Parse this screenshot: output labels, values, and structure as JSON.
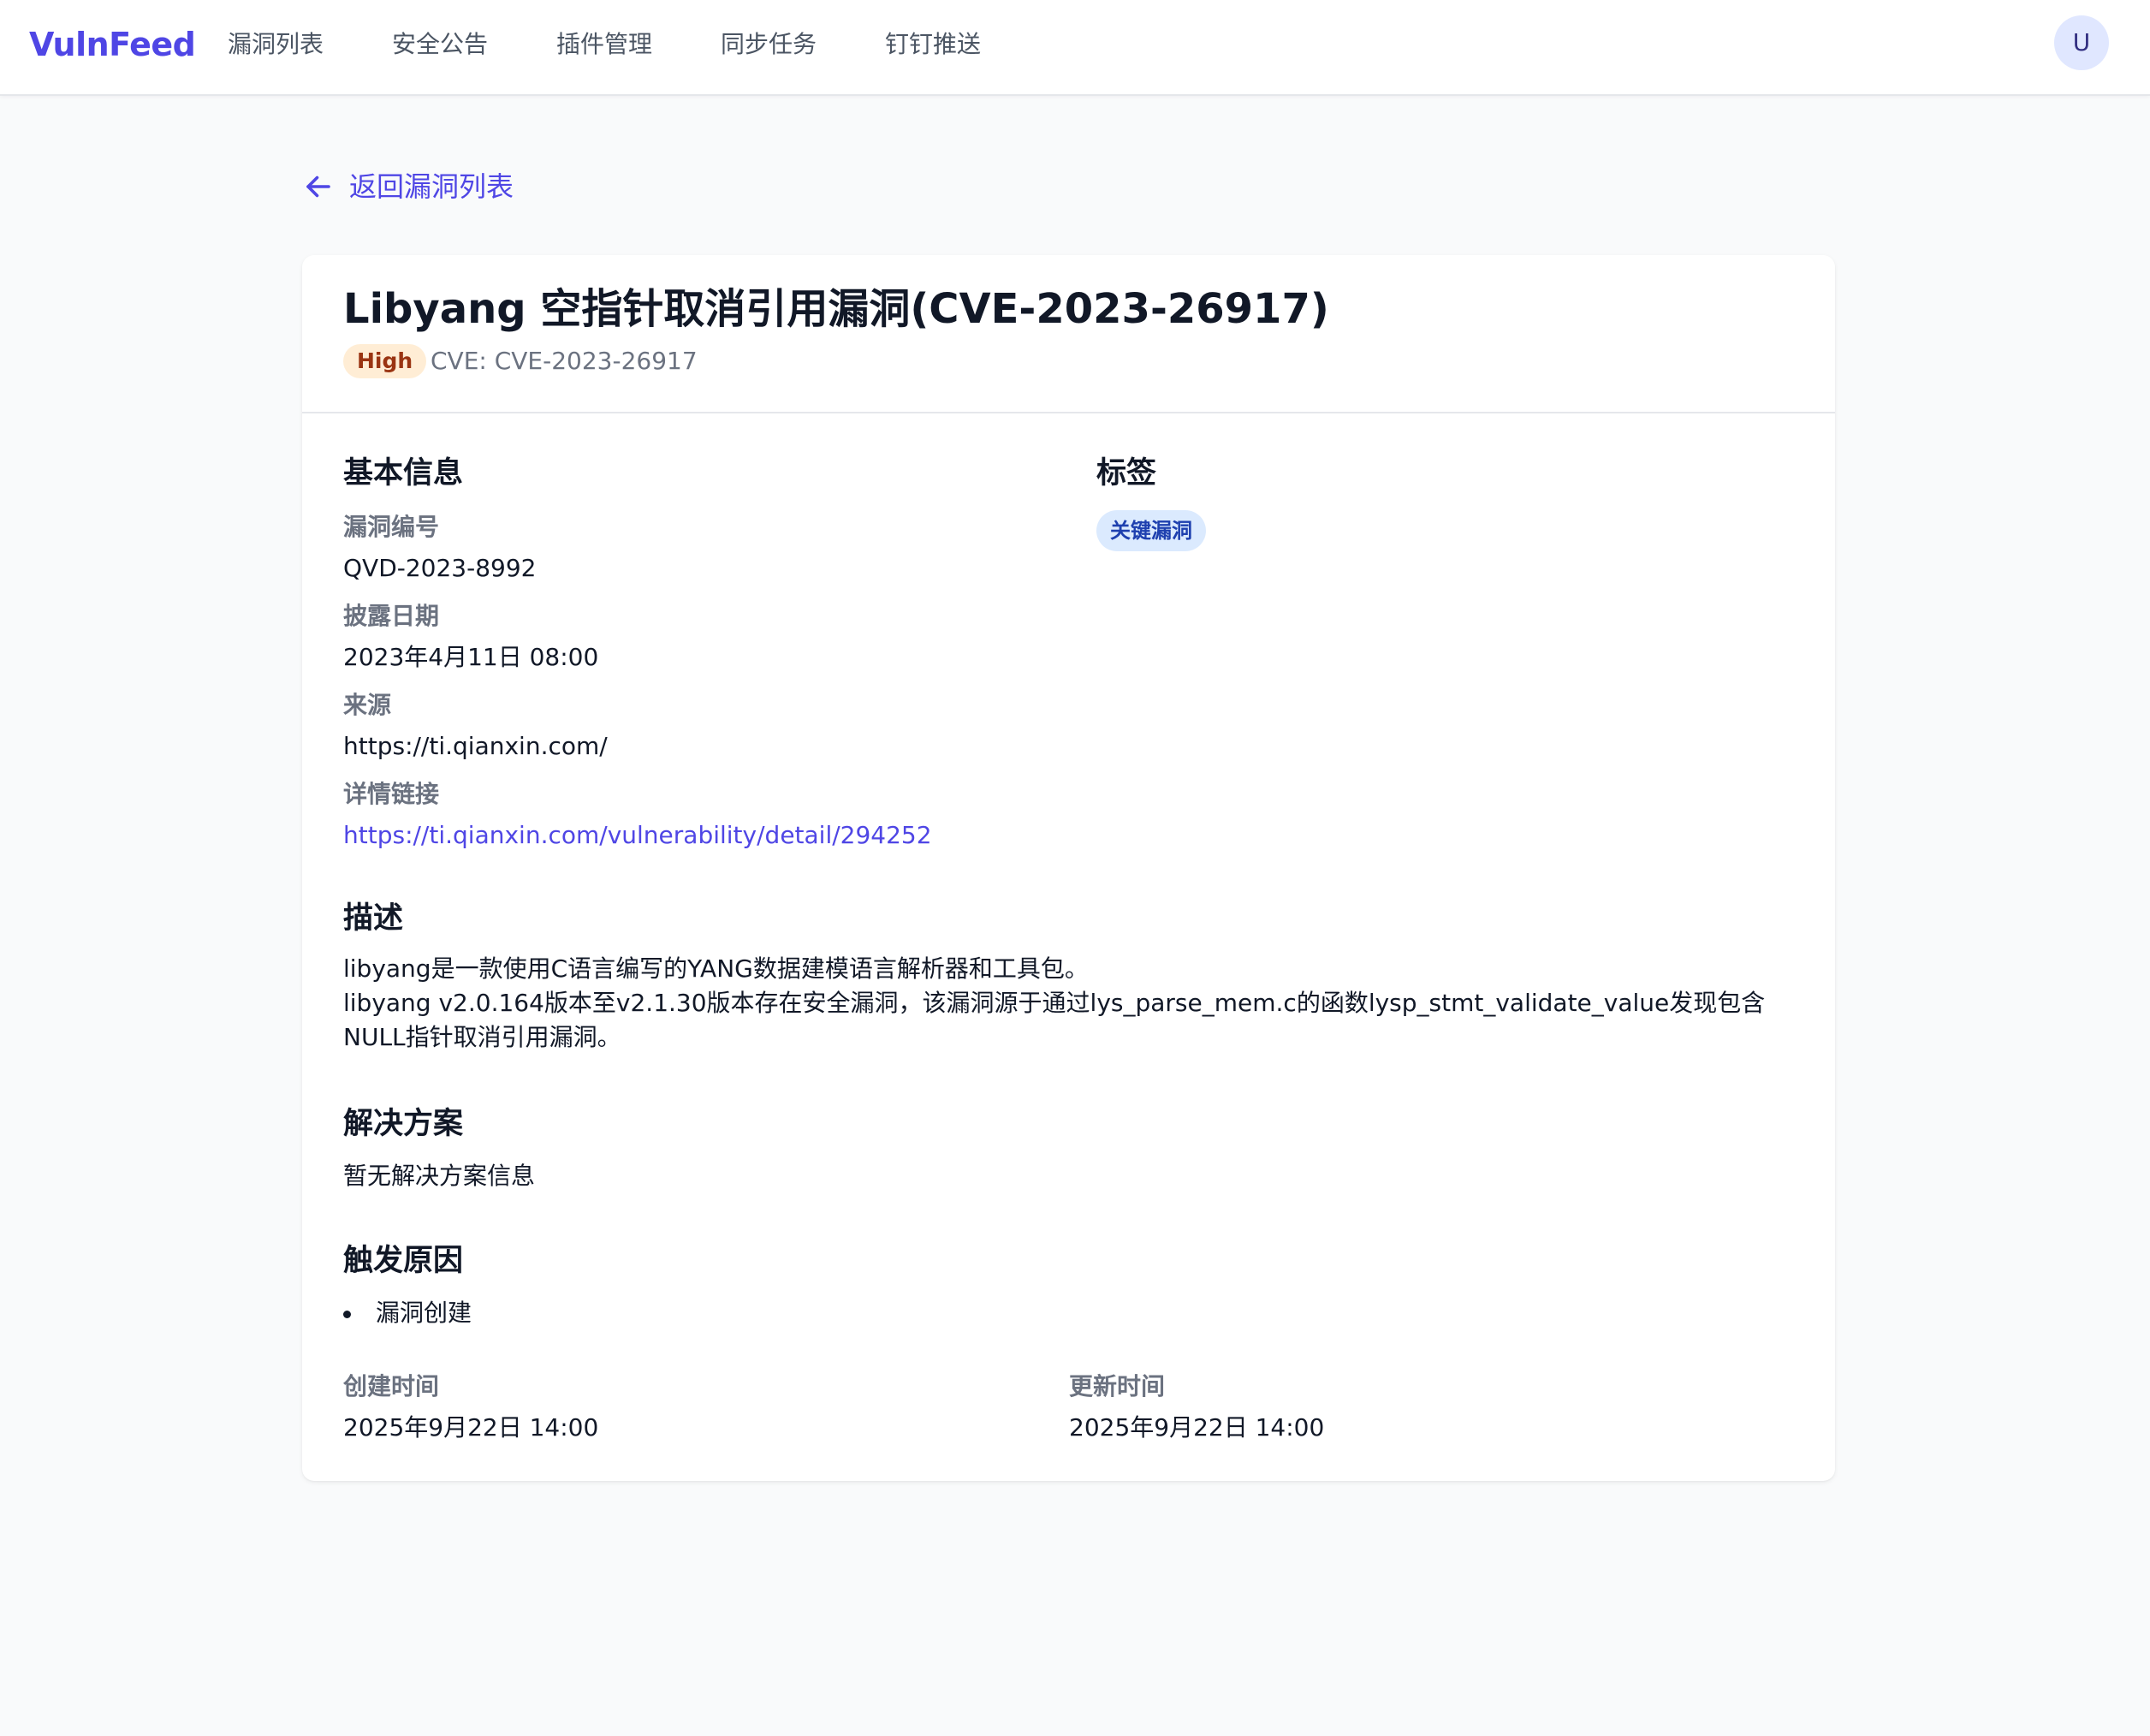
{
  "brand": "VulnFeed",
  "nav": {
    "items": [
      "漏洞列表",
      "安全公告",
      "插件管理",
      "同步任务",
      "钉钉推送"
    ]
  },
  "user": {
    "avatar_letter": "U"
  },
  "back_link": "返回漏洞列表",
  "vuln": {
    "title": "Libyang 空指针取消引用漏洞(CVE-2023-26917)",
    "severity": "High",
    "cve_line": "CVE: CVE-2023-26917"
  },
  "basic_info": {
    "heading": "基本信息",
    "id_label": "漏洞编号",
    "id_value": "QVD-2023-8992",
    "disclosure_label": "披露日期",
    "disclosure_value": "2023年4月11日 08:00",
    "source_label": "来源",
    "source_value": "https://ti.qianxin.com/",
    "detail_label": "详情链接",
    "detail_value": "https://ti.qianxin.com/vulnerability/detail/294252"
  },
  "tags": {
    "heading": "标签",
    "items": [
      "关键漏洞"
    ]
  },
  "description": {
    "heading": "描述",
    "line1": "libyang是一款使用C语言编写的YANG数据建模语言解析器和工具包。",
    "line2": "libyang v2.0.164版本至v2.1.30版本存在安全漏洞，该漏洞源于通过lys_parse_mem.c的函数lysp_stmt_validate_value发现包含NULL指针取消引用漏洞。"
  },
  "solution": {
    "heading": "解决方案",
    "text": "暂无解决方案信息"
  },
  "trigger": {
    "heading": "触发原因",
    "items": [
      "漏洞创建"
    ]
  },
  "timestamps": {
    "created_label": "创建时间",
    "created_value": "2025年9月22日 14:00",
    "updated_label": "更新时间",
    "updated_value": "2025年9月22日 14:00"
  },
  "colors": {
    "accent": "#4f46e5",
    "high_badge_bg": "#ffedd5",
    "high_badge_text": "#9a3412",
    "tag_bg": "#dbeafe",
    "tag_text": "#1e40af"
  },
  "icons": {
    "back": "arrow-left-icon"
  }
}
